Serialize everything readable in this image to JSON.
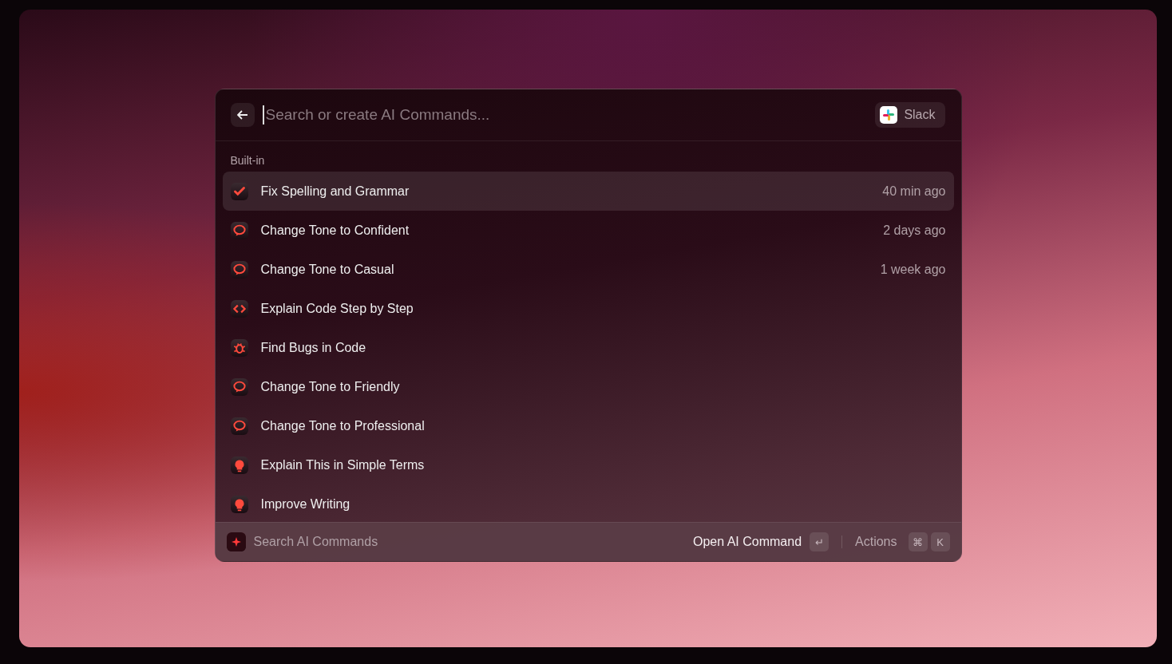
{
  "search": {
    "placeholder": "Search or create AI Commands..."
  },
  "app_chip": {
    "label": "Slack"
  },
  "section": {
    "title": "Built-in"
  },
  "items": [
    {
      "kind": "check",
      "label": "Fix Spelling and Grammar",
      "time": "40 min ago",
      "selected": true
    },
    {
      "kind": "speech",
      "label": "Change Tone to Confident",
      "time": "2 days ago",
      "selected": false
    },
    {
      "kind": "speech",
      "label": "Change Tone to Casual",
      "time": "1 week ago",
      "selected": false
    },
    {
      "kind": "code",
      "label": "Explain Code Step by Step",
      "selected": false
    },
    {
      "kind": "bug",
      "label": "Find Bugs in Code",
      "selected": false
    },
    {
      "kind": "speech",
      "label": "Change Tone to Friendly",
      "selected": false
    },
    {
      "kind": "speech",
      "label": "Change Tone to Professional",
      "selected": false
    },
    {
      "kind": "bulb",
      "label": "Explain This in Simple Terms",
      "selected": false
    },
    {
      "kind": "bulb",
      "label": "Improve Writing",
      "selected": false
    }
  ],
  "footer": {
    "title": "Search AI Commands",
    "primary_action": "Open AI Command",
    "primary_key": "↵",
    "secondary_action": "Actions",
    "secondary_keys": [
      "⌘",
      "K"
    ]
  }
}
